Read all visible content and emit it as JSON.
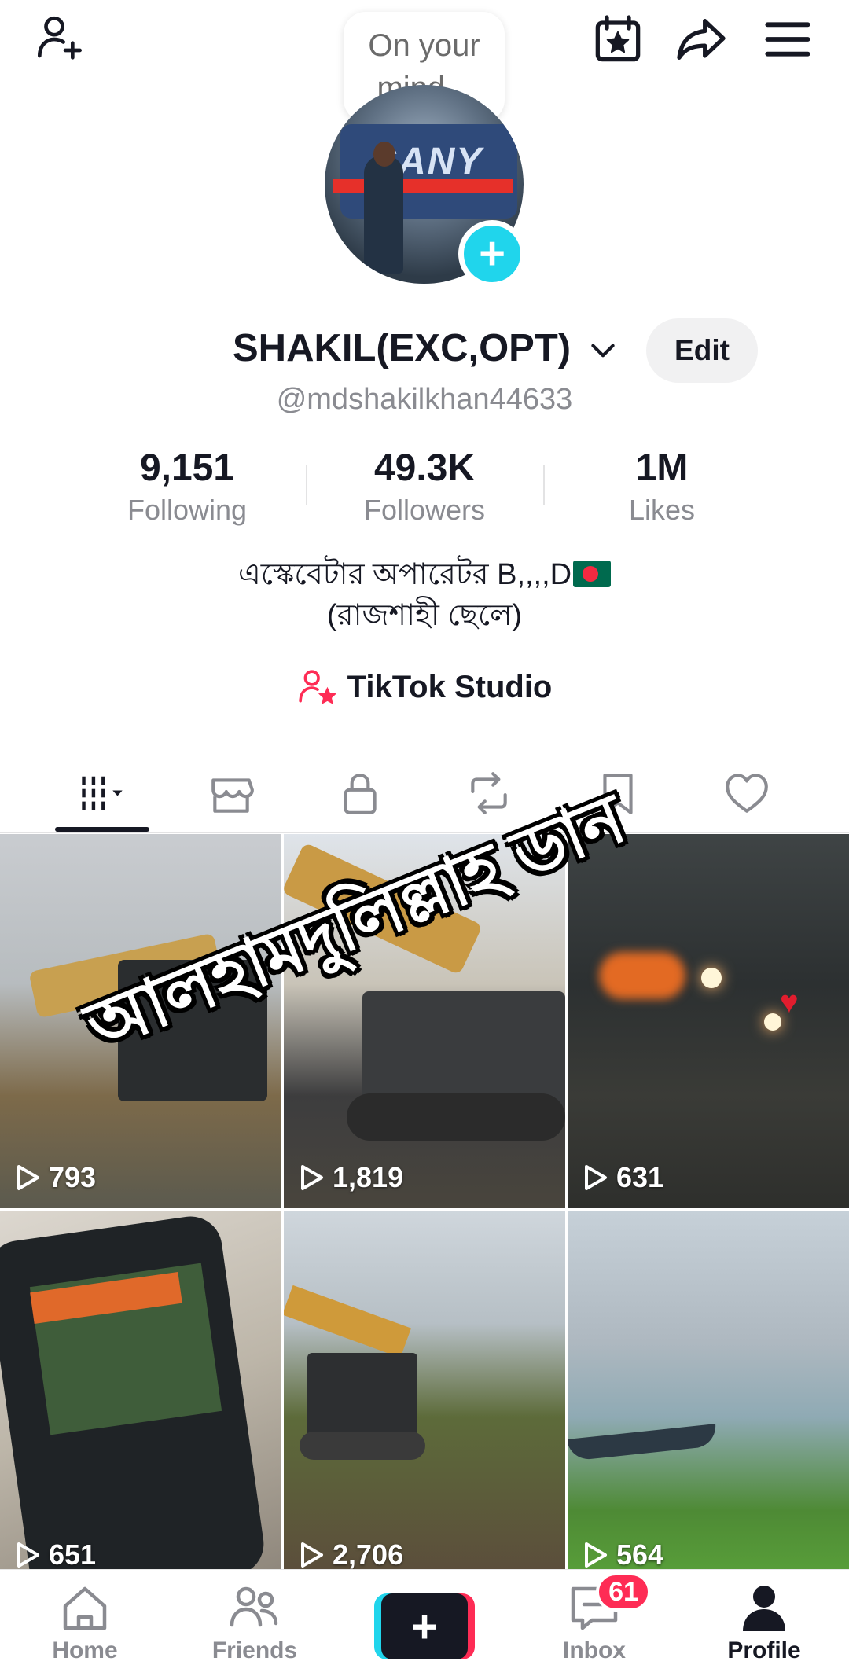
{
  "header": {
    "add_friend_icon": "person-plus-icon",
    "bubble_text": "On your mind...",
    "calendar_icon": "calendar-star-icon",
    "share_icon": "share-arrow-icon",
    "menu_icon": "hamburger-icon"
  },
  "profile": {
    "display_name": "SHAKIL(EXC,OPT)",
    "handle": "@mdshakilkhan44633",
    "edit_label": "Edit",
    "avatar_brand": "SANY"
  },
  "stats": [
    {
      "value": "9,151",
      "label": "Following"
    },
    {
      "value": "49.3K",
      "label": "Followers"
    },
    {
      "value": "1M",
      "label": "Likes"
    }
  ],
  "bio": {
    "line1": "এস্কেবেটার অপারেটর B,,,,D",
    "line2": "(রাজশাহী ছেলে)"
  },
  "studio": {
    "label": "TikTok Studio"
  },
  "tabs": [
    "videos",
    "shop",
    "private",
    "reposts",
    "saved",
    "liked"
  ],
  "videos": [
    {
      "views": "793"
    },
    {
      "views": "1,819"
    },
    {
      "views": "631"
    },
    {
      "views": "651"
    },
    {
      "views": "2,706"
    },
    {
      "views": "564"
    }
  ],
  "overlay_text": "আলহামদুলিল্লাহ ডান",
  "bottom_nav": {
    "home": "Home",
    "friends": "Friends",
    "inbox": "Inbox",
    "profile": "Profile",
    "inbox_badge": "61"
  }
}
